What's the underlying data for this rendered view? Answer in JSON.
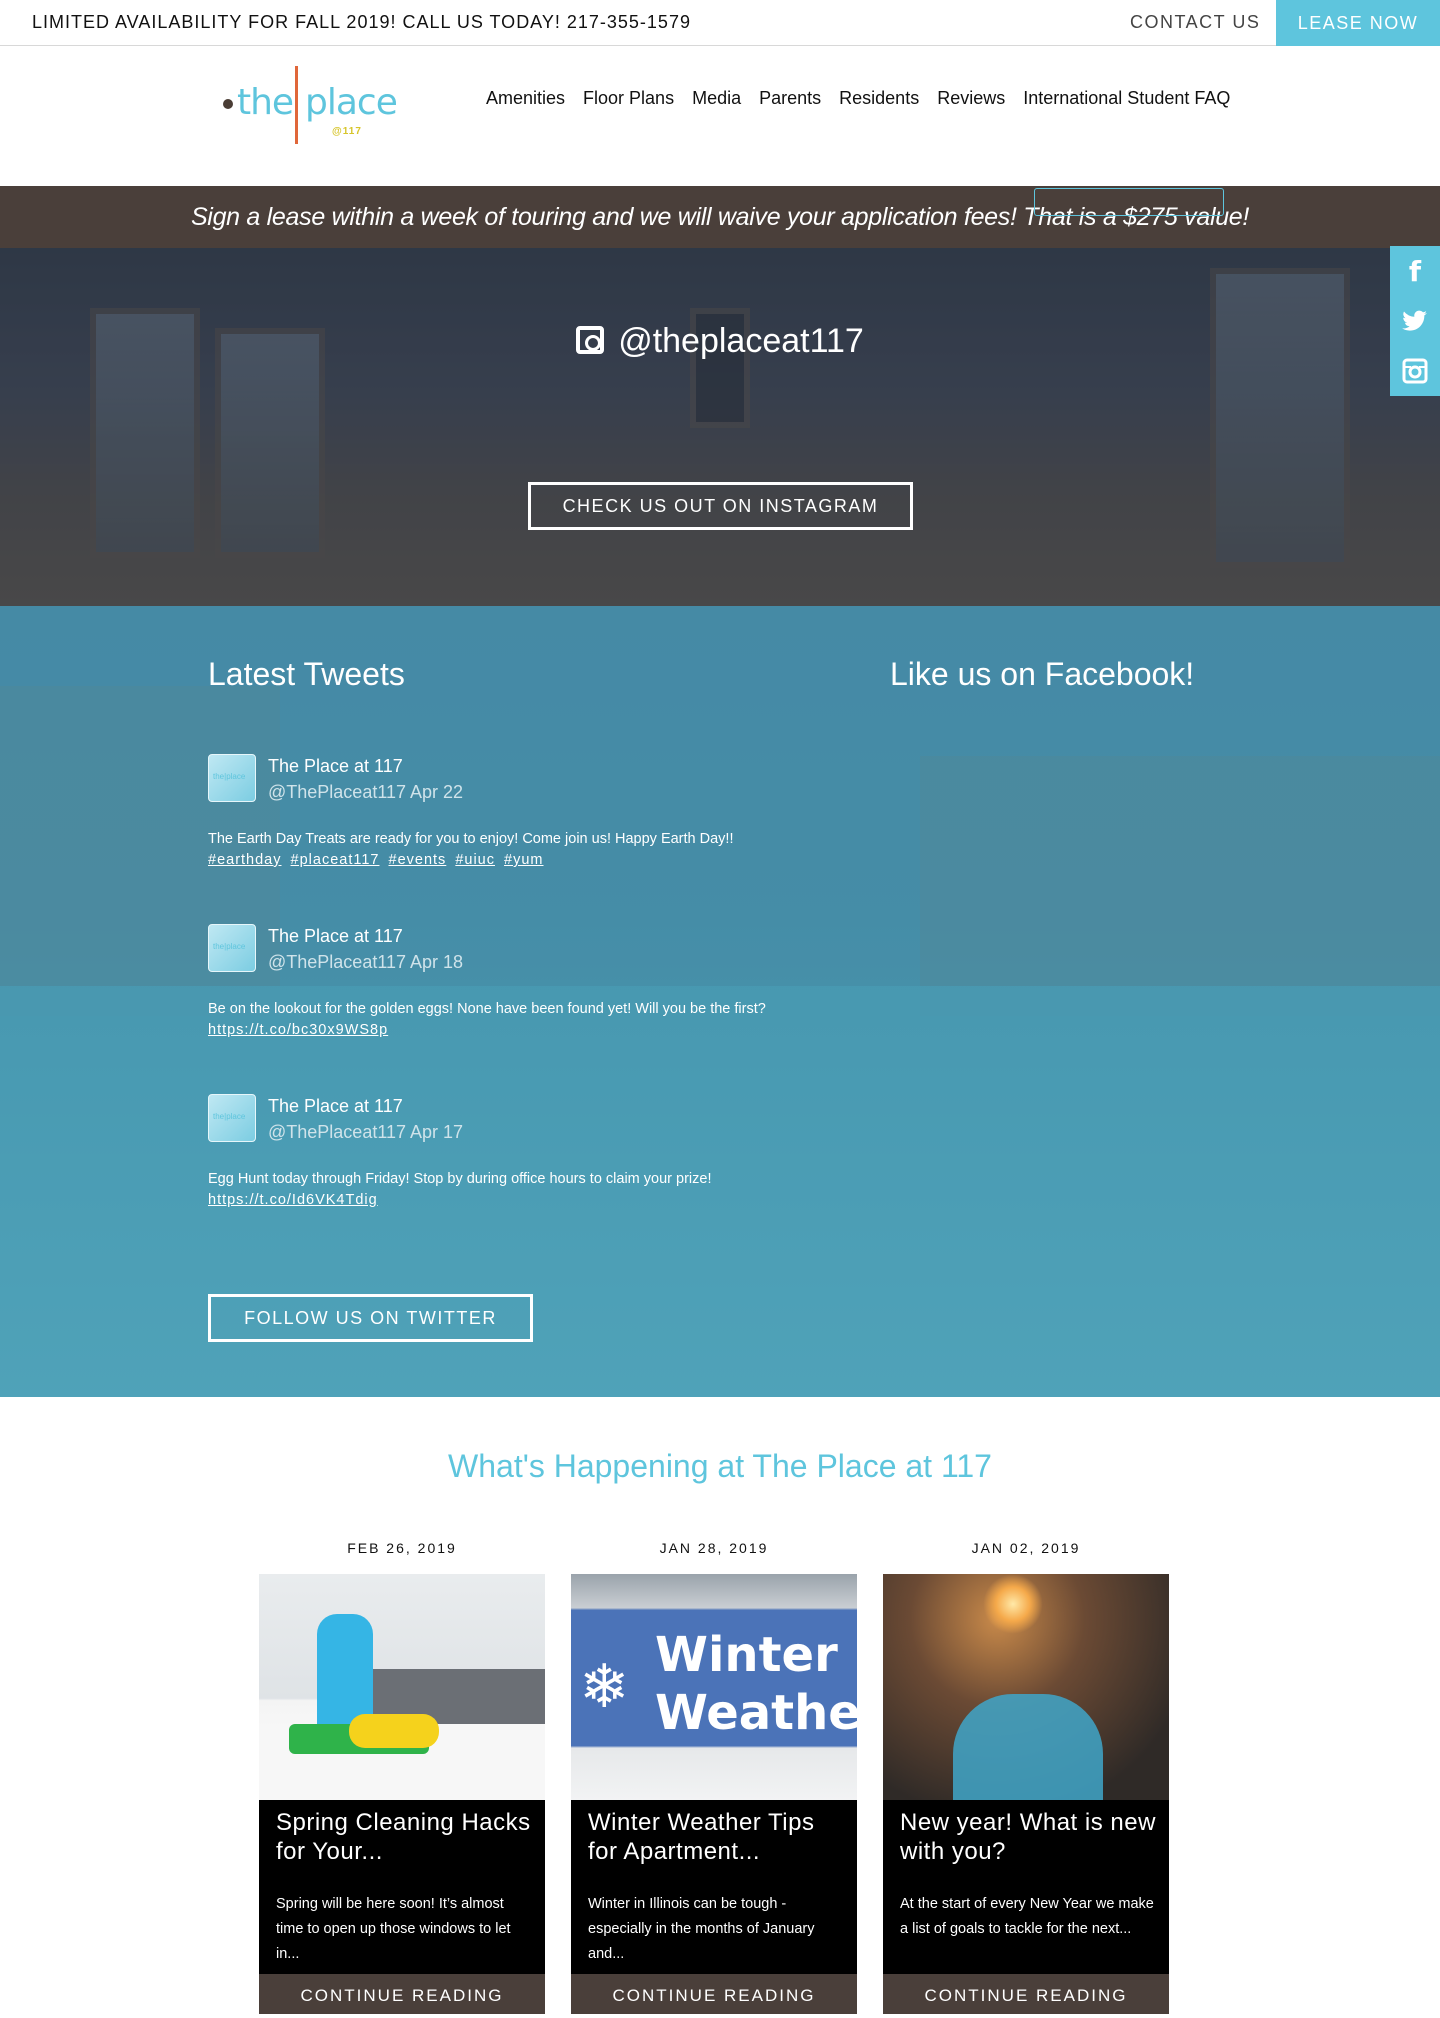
{
  "topbar": {
    "promo": "LIMITED AVAILABILITY FOR FALL 2019! CALL US TODAY! 217-355-1579",
    "contact": "CONTACT US",
    "lease": "LEASE NOW"
  },
  "header": {
    "logo_the": "the",
    "logo_place": "place",
    "logo_num": "@117",
    "nav": [
      "Amenities",
      "Floor Plans",
      "Media",
      "Parents",
      "Residents",
      "Reviews",
      "International Student FAQ"
    ],
    "active_nav": "Media"
  },
  "banner": {
    "text": "Sign a lease within a week of touring and we will waive your application fees! That is a $275 value!"
  },
  "social": {
    "icons": [
      "facebook-icon",
      "twitter-icon",
      "instagram-icon"
    ],
    "glyphs": [
      "f",
      "t",
      "◎"
    ]
  },
  "instagram": {
    "handle": "@theplaceat117",
    "button": "CHECK US OUT ON INSTAGRAM"
  },
  "tweets_section": {
    "heading": "Latest Tweets",
    "facebook_heading": "Like us on Facebook!",
    "tweets": [
      {
        "name": "The Place at 117",
        "meta": "@ThePlaceat117 Apr 22",
        "body": "The Earth Day Treats are ready for you to enjoy! Come join us! Happy Earth Day!!",
        "links": [
          "#earthday",
          "#placeat117",
          "#events",
          "#uiuc",
          "#yum"
        ]
      },
      {
        "name": "The Place at 117",
        "meta": "@ThePlaceat117 Apr 18",
        "body": "Be on the lookout for the golden eggs! None have been found yet! Will you be the first?",
        "links": [
          "https://t.co/bc30x9WS8p"
        ]
      },
      {
        "name": "The Place at 117",
        "meta": "@ThePlaceat117 Apr 17",
        "body": "Egg Hunt today through Friday! Stop by during office hours to claim your prize!",
        "links": [
          "https://t.co/Id6VK4Tdig"
        ]
      }
    ],
    "follow_button": "FOLLOW US ON TWITTER"
  },
  "happening": {
    "heading": "What's Happening at The Place at 117",
    "posts": [
      {
        "date": "FEB 26, 2019",
        "title": "Spring Cleaning Hacks for Your...",
        "excerpt": "Spring will be here soon!  It’s almost time to open up those windows to let in...",
        "more": "CONTINUE READING"
      },
      {
        "date": "JAN 28, 2019",
        "title": "Winter Weather Tips for Apartment...",
        "excerpt": "Winter in Illinois can be tough - especially in the months of January and...",
        "more": "CONTINUE READING",
        "image_text": "Winter Weather"
      },
      {
        "date": "JAN 02, 2019",
        "title": "New year! What is new with you?",
        "excerpt": "At the start of every New Year we make a list of goals to tackle for the next...",
        "more": "CONTINUE READING"
      }
    ]
  },
  "colors": {
    "accent": "#5ec5dd",
    "dark": "#4a3f3a",
    "logo_bar": "#e0673a"
  }
}
